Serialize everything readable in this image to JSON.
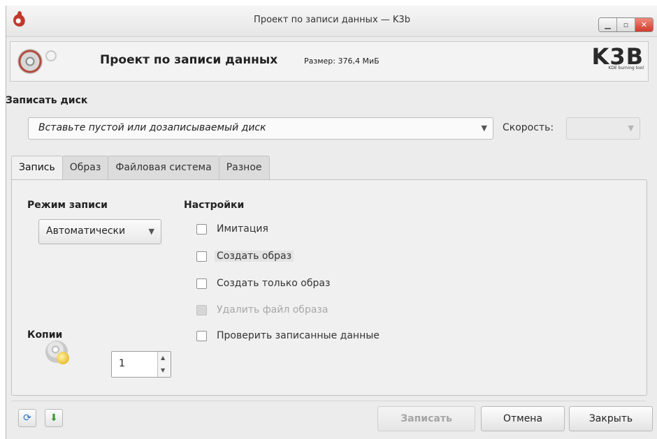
{
  "window": {
    "title": "Проект по записи данных — K3b",
    "controls": [
      "minimize",
      "maximize",
      "close"
    ]
  },
  "header": {
    "title": "Проект по записи данных",
    "size_text": "Размер: 376,4 МиБ",
    "logo_text": "K3B",
    "logo_subtitle": "KDE burning tool"
  },
  "burn_disc": {
    "label": "Записать диск",
    "disc_placeholder": "Вставьте пустой или дозаписываемый диск",
    "speed_label": "Скорость:",
    "speed_value": ""
  },
  "tabs": [
    {
      "label": "Запись",
      "active": true
    },
    {
      "label": "Образ",
      "active": false
    },
    {
      "label": "Файловая система",
      "active": false
    },
    {
      "label": "Разное",
      "active": false
    }
  ],
  "write_tab": {
    "mode_heading": "Режим записи",
    "mode_value": "Автоматически",
    "settings_heading": "Настройки",
    "options": [
      {
        "label": "Имитация",
        "checked": false,
        "enabled": true
      },
      {
        "label": "Создать образ",
        "checked": false,
        "enabled": true
      },
      {
        "label": "Создать только образ",
        "checked": false,
        "enabled": true
      },
      {
        "label": "Удалить файл образа",
        "checked": false,
        "enabled": false
      },
      {
        "label": "Проверить записанные данные",
        "checked": false,
        "enabled": true
      }
    ],
    "copies_heading": "Копии",
    "copies_value": "1"
  },
  "footer": {
    "burn_button": "Записать",
    "cancel_button": "Отмена",
    "close_button": "Закрыть"
  }
}
